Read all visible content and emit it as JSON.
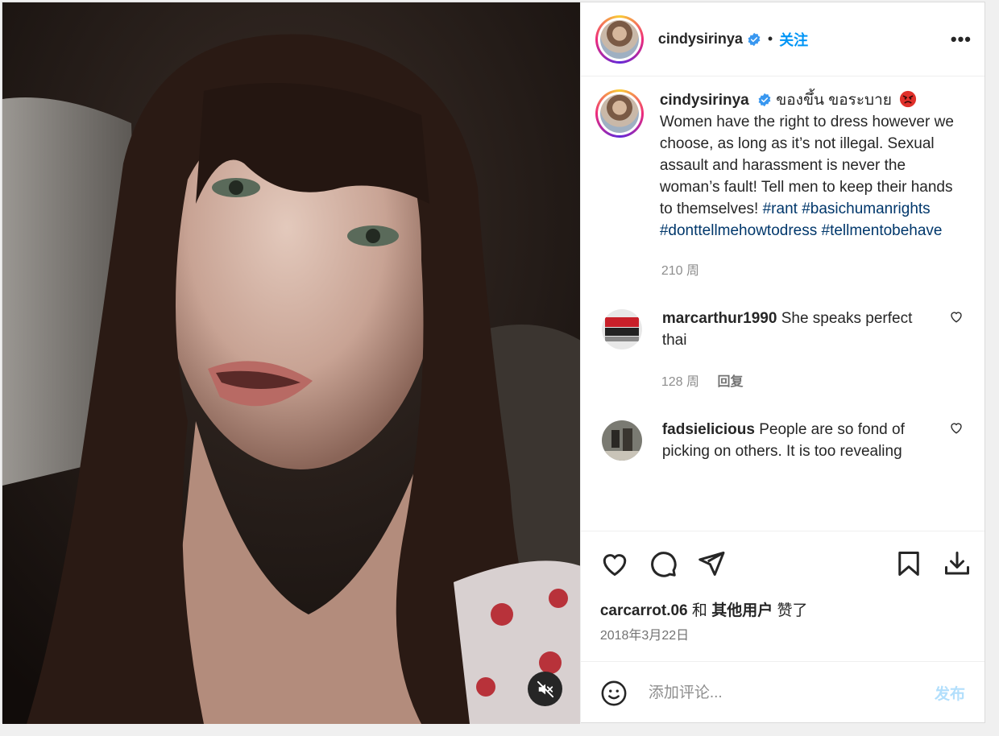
{
  "header": {
    "username": "cindysirinya",
    "separator": "•",
    "follow_label": "关注",
    "more_label": "•••"
  },
  "caption": {
    "username": "cindysirinya",
    "thai": "ของขึ้น ขอระบาย",
    "text": "Women have the right to dress however we choose, as long as it’s not illegal. Sexual assault and harassment is never the woman’s fault! Tell men to keep their hands to themselves!",
    "hashtags": [
      "#rant",
      "#basichumanrights",
      "#donttellmehowtodress",
      "#tellmentobehave"
    ],
    "age": "210 周"
  },
  "comments": [
    {
      "username": "marcarthur1990",
      "text": "She speaks perfect thai",
      "age": "128 周",
      "reply_label": "回复"
    },
    {
      "username": "fadsielicious",
      "text": "People are so fond of picking on others. It is too revealing",
      "age": "",
      "reply_label": ""
    }
  ],
  "likes": {
    "user": "carcarrot.06",
    "and": "和",
    "others": "其他用户",
    "suffix": "赞了"
  },
  "date": "2018年3月22日",
  "add_comment": {
    "placeholder": "添加评论...",
    "post_label": "发布"
  },
  "icons": {
    "like": "heart-icon",
    "comment": "comment-icon",
    "share": "send-icon",
    "save": "bookmark-icon",
    "download": "download-icon",
    "mute": "speaker-muted-icon",
    "emoji": "smiley-icon",
    "verified": "verified-badge-icon",
    "angry": "angry-face-emoji"
  },
  "colors": {
    "accent": "#0095f6",
    "post_disabled": "#b2dffc",
    "hashtag": "#00376b",
    "verified": "#3897f0"
  }
}
